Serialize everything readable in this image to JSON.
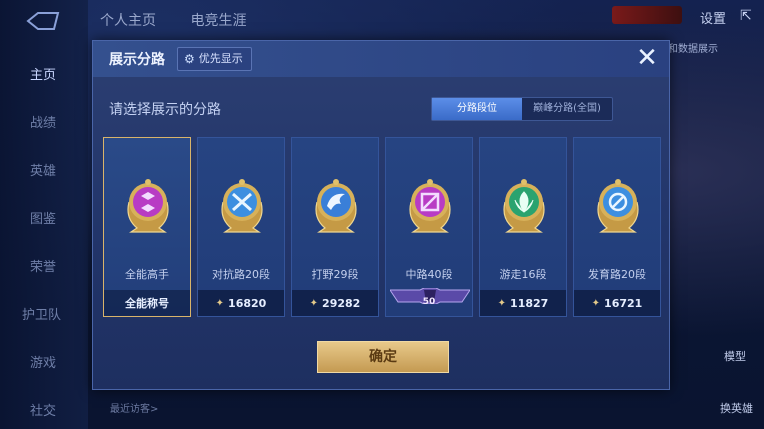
{
  "background": {
    "top_tabs": [
      "个人主页",
      "电竞生涯"
    ],
    "settings_label": "设置",
    "right_note": "和数据展示",
    "model_label": "模型",
    "swap_hero_label": "换英雄",
    "recent_visitor": "最近访客>",
    "nav": [
      {
        "label": "主页",
        "active": true
      },
      {
        "label": "战绩",
        "active": false
      },
      {
        "label": "英雄",
        "active": false
      },
      {
        "label": "图鉴",
        "active": false
      },
      {
        "label": "荣誉",
        "active": false
      },
      {
        "label": "护卫队",
        "active": false
      },
      {
        "label": "游戏",
        "active": false
      },
      {
        "label": "社交",
        "active": false
      }
    ]
  },
  "modal": {
    "title": "展示分路",
    "priority_label": "优先显示",
    "subtitle": "请选择展示的分路",
    "toggle": {
      "options": [
        "分路段位",
        "巅峰分路(全国)"
      ],
      "selected": "分路段位"
    },
    "cards": [
      {
        "name": "全能高手",
        "footer": "全能称号",
        "emblem": "allround-emblem-icon",
        "color": "#b83cc4",
        "selected": true
      },
      {
        "name": "对抗路20段",
        "footer": "16820",
        "emblem": "clash-lane-emblem-icon",
        "color": "#3d8fe0",
        "selected": false
      },
      {
        "name": "打野29段",
        "footer": "29282",
        "emblem": "jungle-emblem-icon",
        "color": "#3a7fd8",
        "selected": false
      },
      {
        "name": "中路40段",
        "footer": "50",
        "emblem": "mid-lane-emblem-icon",
        "color": "#b83cc4",
        "selected": false
      },
      {
        "name": "游走16段",
        "footer": "11827",
        "emblem": "roam-emblem-icon",
        "color": "#2aa36f",
        "selected": false
      },
      {
        "name": "发育路20段",
        "footer": "16721",
        "emblem": "farm-lane-emblem-icon",
        "color": "#3d8fe0",
        "selected": false
      }
    ],
    "confirm_label": "确定"
  }
}
